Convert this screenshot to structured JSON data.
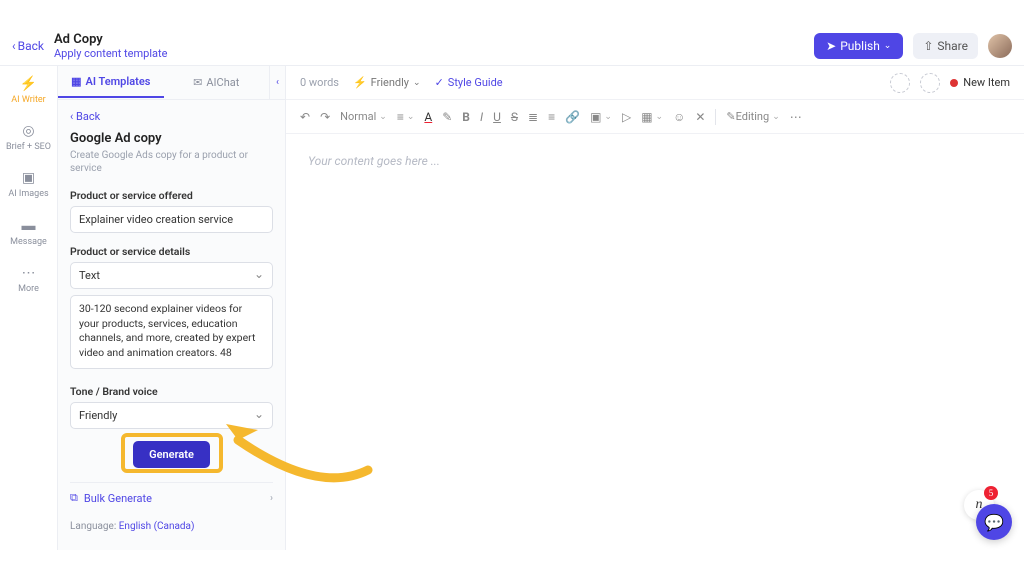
{
  "header": {
    "back": "Back",
    "title": "Ad Copy",
    "subtitle": "Apply content template",
    "publish": "Publish",
    "share": "Share"
  },
  "leftnav": {
    "items": [
      {
        "label": "AI Writer"
      },
      {
        "label": "Brief + SEO"
      },
      {
        "label": "AI Images"
      },
      {
        "label": "Message"
      },
      {
        "label": "More"
      }
    ]
  },
  "panel": {
    "tabs": {
      "templates": "AI Templates",
      "chat": "AIChat"
    },
    "back": "Back",
    "title": "Google Ad copy",
    "desc": "Create Google Ads copy for a product or service",
    "field1_label": "Product or service offered",
    "field1_value": "Explainer video creation service",
    "field2_label": "Product or service details",
    "field2_type": "Text",
    "field2_value": "30-120 second explainer videos for your products, services, education channels, and more, created by expert video and animation creators. 48",
    "field3_label": "Tone / Brand voice",
    "field3_value": "Friendly",
    "generate": "Generate",
    "bulk": "Bulk Generate",
    "lang_label": "Language:",
    "lang_value": "English (Canada)"
  },
  "editor": {
    "word_count": "0 words",
    "tone": "Friendly",
    "style_guide": "Style Guide",
    "new_item": "New Item",
    "format": "Normal",
    "mode": "Editing",
    "placeholder": "Your content goes here ..."
  },
  "notify_count": "5"
}
